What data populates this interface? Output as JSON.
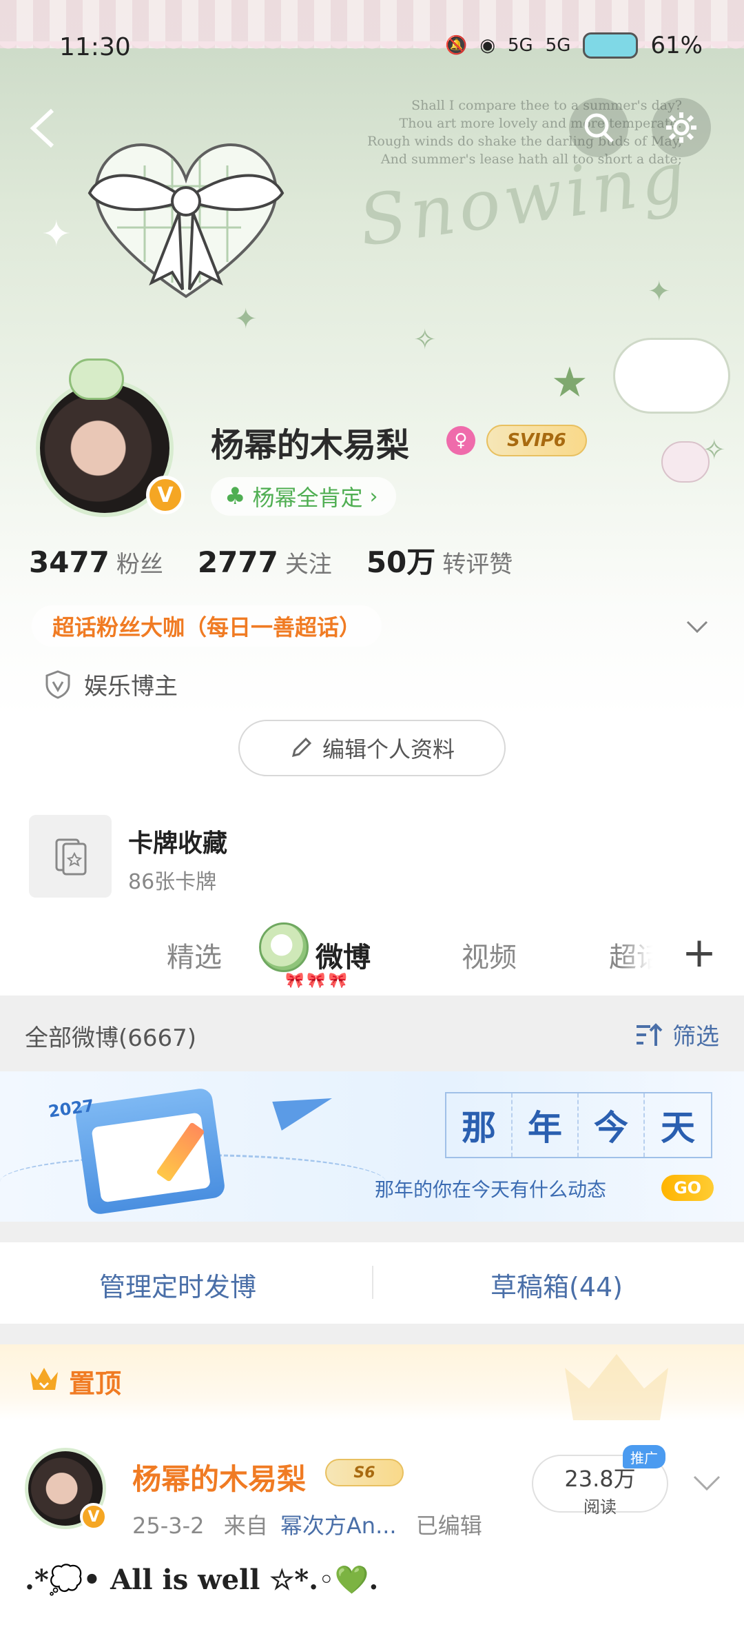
{
  "status_bar": {
    "time": "11:30",
    "battery": "61%",
    "network_1": "5G",
    "network_2": "5G"
  },
  "header": {
    "poem": [
      "Shall I compare thee to a summer's day?",
      "Thou art more lovely and more temperate:",
      "Rough winds do shake the darling buds of May,",
      "And summer's lease hath all too short a date;"
    ],
    "banner_word": "Snowing"
  },
  "profile": {
    "name": "杨幂的木易梨",
    "vip_badge": "SVIP6",
    "verified_mark": "V",
    "gender_symbol": "♀",
    "fanclub": "杨幂全肯定",
    "fanclub_arrow": "›",
    "stats": [
      {
        "num": "3477",
        "label": "粉丝"
      },
      {
        "num": "2777",
        "label": "关注"
      },
      {
        "num": "50万",
        "label": "转评赞"
      }
    ],
    "supertopic": "超话粉丝大咖（每日一善超话）",
    "role": "娱乐博主",
    "edit_label": "编辑个人资料"
  },
  "card": {
    "title": "卡牌收藏",
    "subtitle": "86张卡牌"
  },
  "tabs": [
    {
      "label": "精选",
      "active": false
    },
    {
      "label": "微博",
      "active": true
    },
    {
      "label": "视频",
      "active": false
    },
    {
      "label": "超话",
      "active": false
    }
  ],
  "tabs_plus": "+",
  "filter": {
    "all_label": "全部微博(6667)",
    "filter_label": "筛选"
  },
  "on_this_day": {
    "year": "2027",
    "chars": [
      "那",
      "年",
      "今",
      "天"
    ],
    "subtitle": "那年的你在今天有什么动态",
    "go": "GO"
  },
  "actions": {
    "scheduled": "管理定时发博",
    "drafts": "草稿箱(44)"
  },
  "pinned": {
    "label": "置顶"
  },
  "post": {
    "name": "杨幂的木易梨",
    "vip_badge": "S6",
    "verified_mark": "V",
    "date": "25-3-2",
    "from_label": "来自",
    "source": "幂次方An...",
    "edited": "已编辑",
    "reads_num": "23.8万",
    "reads_label": "阅读",
    "promo": "推广",
    "text": ".*💭• All is well ☆*.◦💚."
  },
  "colors": {
    "accent_orange": "#f07b23",
    "link_blue": "#4a6fa8",
    "vip_gold": "#f9d98a",
    "green": "#4fae52"
  }
}
